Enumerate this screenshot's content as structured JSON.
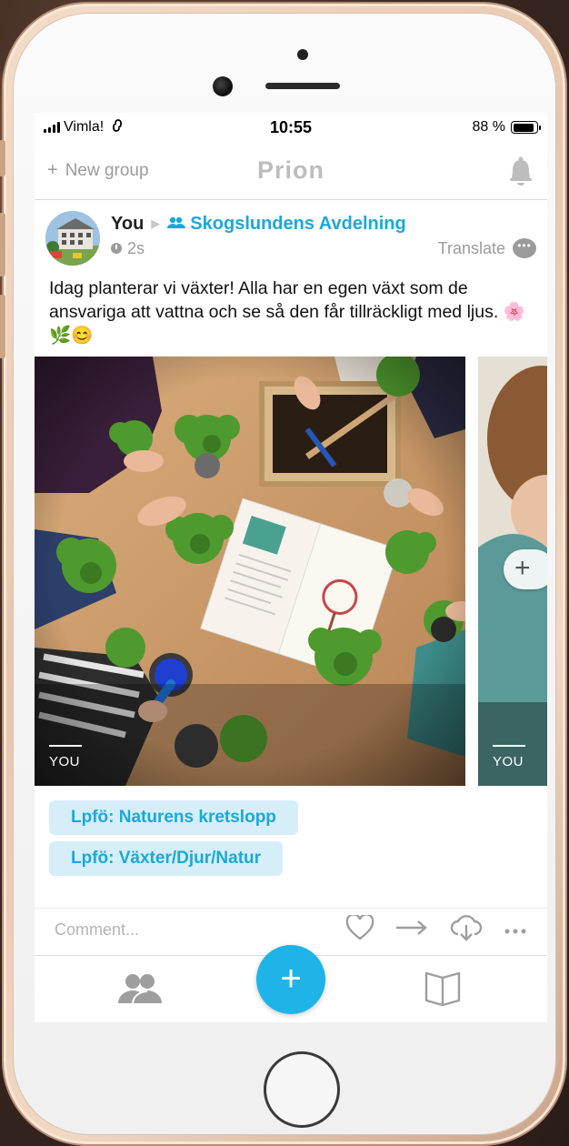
{
  "status_bar": {
    "carrier": "Vimla!",
    "time": "10:55",
    "battery_percent_text": "88 %",
    "battery_level": 0.88
  },
  "header": {
    "new_group_label": "New group",
    "title": "Prion",
    "bell_icon": "bell-icon"
  },
  "post": {
    "author": "You",
    "group": "Skogslundens Avdelning",
    "time_ago": "2s",
    "translate_label": "Translate",
    "text": "Idag planterar vi växter! Alla har en egen växt som de ansvariga att vattna och se så den får tillräckligt med ljus. 🌸🌿😊",
    "photos": [
      {
        "label": "YOU"
      },
      {
        "label": "YOU"
      }
    ],
    "tags": [
      "Lpfö: Naturens kretslopp",
      "Lpfö: Växter/Djur/Natur"
    ]
  },
  "comment": {
    "placeholder": "Comment..."
  },
  "actions": [
    "heart-icon",
    "share-arrow-icon",
    "cloud-download-icon",
    "more-icon"
  ],
  "tabbar": {
    "left_icon": "groups-icon",
    "center_icon": "add-icon",
    "right_icon": "book-icon",
    "fab_symbol": "+"
  },
  "colors": {
    "accent": "#1fb4e8",
    "link": "#1aa8dc",
    "tag_bg": "#d6eef8"
  }
}
